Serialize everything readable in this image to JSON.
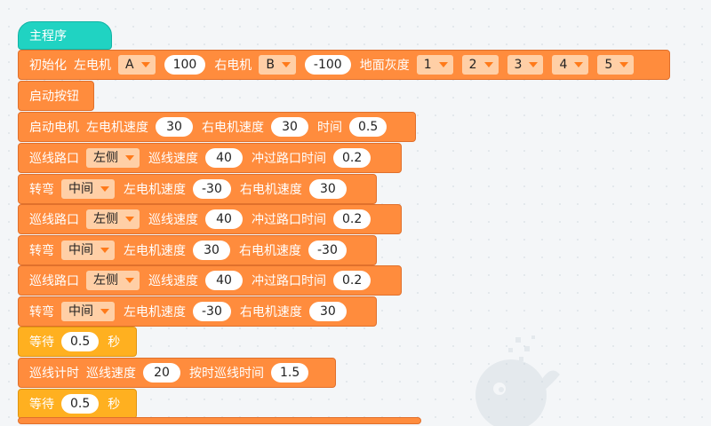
{
  "main_program": {
    "label": "主程序"
  },
  "init": {
    "label": "初始化",
    "left_motor_label": "左电机",
    "left_motor_port": "A",
    "left_motor_value": "100",
    "right_motor_label": "右电机",
    "right_motor_port": "B",
    "right_motor_value": "-100",
    "ground_gray_label": "地面灰度",
    "gray_ports": [
      "1",
      "2",
      "3",
      "4",
      "5"
    ]
  },
  "start_button": {
    "label": "启动按钮"
  },
  "start_motor": {
    "label": "启动电机",
    "left_speed_label": "左电机速度",
    "left_speed": "30",
    "right_speed_label": "右电机速度",
    "right_speed": "30",
    "time_label": "时间",
    "time": "0.5"
  },
  "steps": [
    {
      "type": "line",
      "label": "巡线路口",
      "dir": "左侧",
      "speed_label": "巡线速度",
      "speed": "40",
      "cross_label": "冲过路口时间",
      "cross_time": "0.2"
    },
    {
      "type": "turn",
      "label": "转弯",
      "dir": "中间",
      "left_label": "左电机速度",
      "left": "-30",
      "right_label": "右电机速度",
      "right": "30"
    },
    {
      "type": "line",
      "label": "巡线路口",
      "dir": "左侧",
      "speed_label": "巡线速度",
      "speed": "40",
      "cross_label": "冲过路口时间",
      "cross_time": "0.2"
    },
    {
      "type": "turn",
      "label": "转弯",
      "dir": "中间",
      "left_label": "左电机速度",
      "left": "30",
      "right_label": "右电机速度",
      "right": "-30"
    },
    {
      "type": "line",
      "label": "巡线路口",
      "dir": "左侧",
      "speed_label": "巡线速度",
      "speed": "40",
      "cross_label": "冲过路口时间",
      "cross_time": "0.2"
    },
    {
      "type": "turn",
      "label": "转弯",
      "dir": "中间",
      "left_label": "左电机速度",
      "left": "-30",
      "right_label": "右电机速度",
      "right": "30"
    }
  ],
  "wait1": {
    "label": "等待",
    "value": "0.5",
    "unit": "秒"
  },
  "timed_line": {
    "label": "巡线计时",
    "speed_label": "巡线速度",
    "speed": "20",
    "time_label": "按时巡线时间",
    "time": "1.5"
  },
  "wait2": {
    "label": "等待",
    "value": "0.5",
    "unit": "秒"
  },
  "colors": {
    "hat": "#20d3c2",
    "block": "#ff8c3d",
    "wait": "#ffb020"
  }
}
